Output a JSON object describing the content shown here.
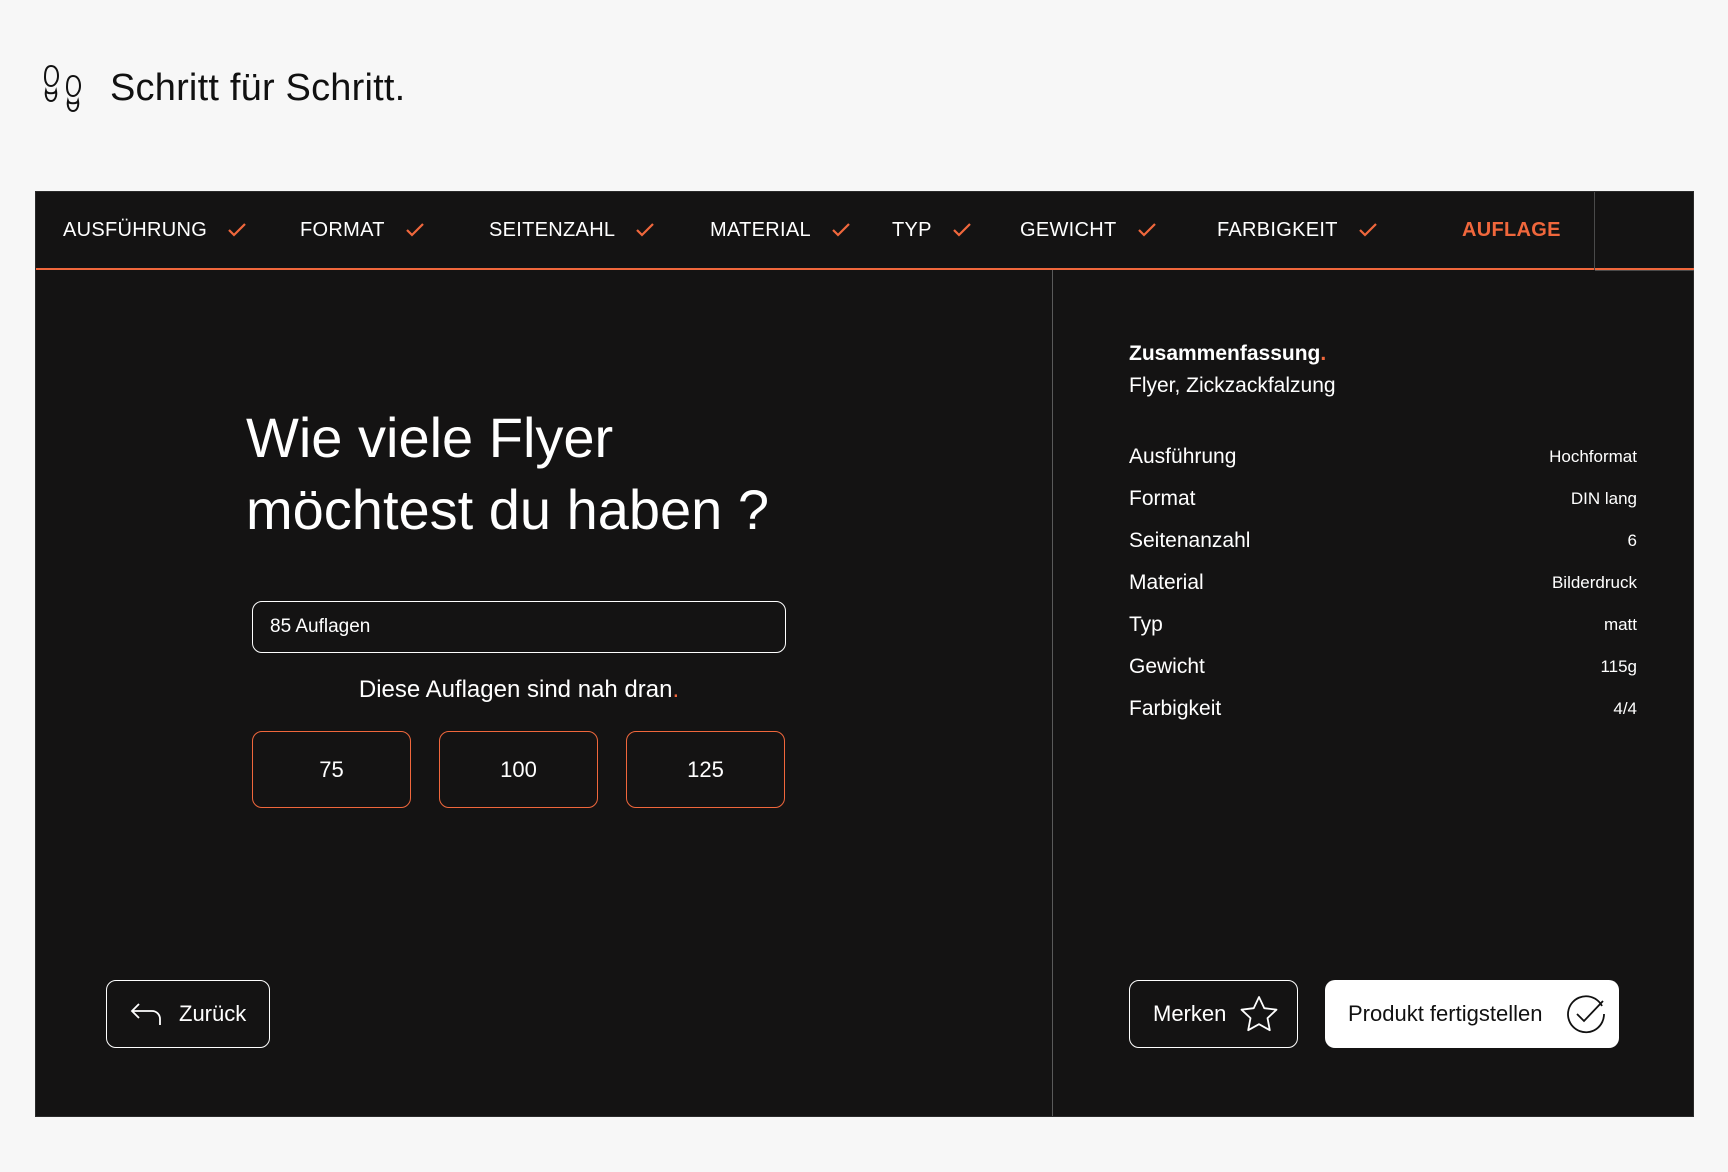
{
  "header": {
    "title": "Schritt für Schritt."
  },
  "steps": [
    {
      "label": "AUSFÜHRUNG",
      "done": true
    },
    {
      "label": "FORMAT",
      "done": true
    },
    {
      "label": "SEITENZAHL",
      "done": true
    },
    {
      "label": "MATERIAL",
      "done": true
    },
    {
      "label": "TYP",
      "done": true
    },
    {
      "label": "GEWICHT",
      "done": true
    },
    {
      "label": "FARBIGKEIT",
      "done": true
    },
    {
      "label": "AUFLAGE",
      "done": false,
      "active": true
    }
  ],
  "main": {
    "question_line1": "Wie viele Flyer",
    "question_line2": "möchtest du haben ?",
    "input_value": "85 Auflagen",
    "hint_text": "Diese Auflagen sind nah dran",
    "hint_dot": ".",
    "suggestions": [
      "75",
      "100",
      "125"
    ],
    "back_label": "Zurück"
  },
  "summary": {
    "title": "Zusammenfassung",
    "title_dot": ".",
    "subtitle": "Flyer, Zickzackfalzung",
    "rows": [
      {
        "key": "Ausführung",
        "value": "Hochformat"
      },
      {
        "key": "Format",
        "value": "DIN lang"
      },
      {
        "key": "Seitenanzahl",
        "value": "6"
      },
      {
        "key": "Material",
        "value": "Bilderdruck"
      },
      {
        "key": "Typ",
        "value": "matt"
      },
      {
        "key": "Gewicht",
        "value": "115g"
      },
      {
        "key": "Farbigkeit",
        "value": "4/4"
      }
    ],
    "save_label": "Merken",
    "finish_label": "Produkt fertigstellen"
  },
  "colors": {
    "accent": "#f0673c",
    "panel": "#141313",
    "page": "#f7f7f7"
  },
  "icons": [
    "footsteps-icon",
    "checkmark-icon",
    "back-arrow-icon",
    "star-icon",
    "check-circle-icon"
  ]
}
